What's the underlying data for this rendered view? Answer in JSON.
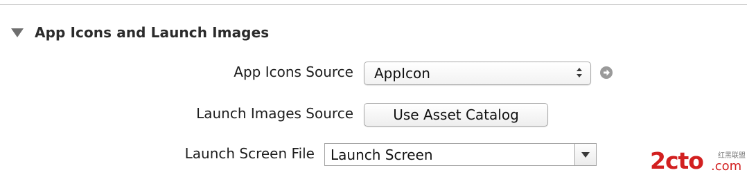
{
  "section": {
    "title": "App Icons and Launch Images"
  },
  "app_icons_source": {
    "label": "App Icons Source",
    "value": "AppIcon"
  },
  "launch_images_source": {
    "label": "Launch Images Source",
    "button_label": "Use Asset Catalog"
  },
  "launch_screen_file": {
    "label": "Launch Screen File",
    "value": "Launch Screen"
  },
  "watermark": {
    "main": "2cto",
    "dotcom": ".com",
    "cn": "红黑联盟"
  },
  "colors": {
    "watermark": "#d22020",
    "go_icon": "#9a9a9a"
  }
}
